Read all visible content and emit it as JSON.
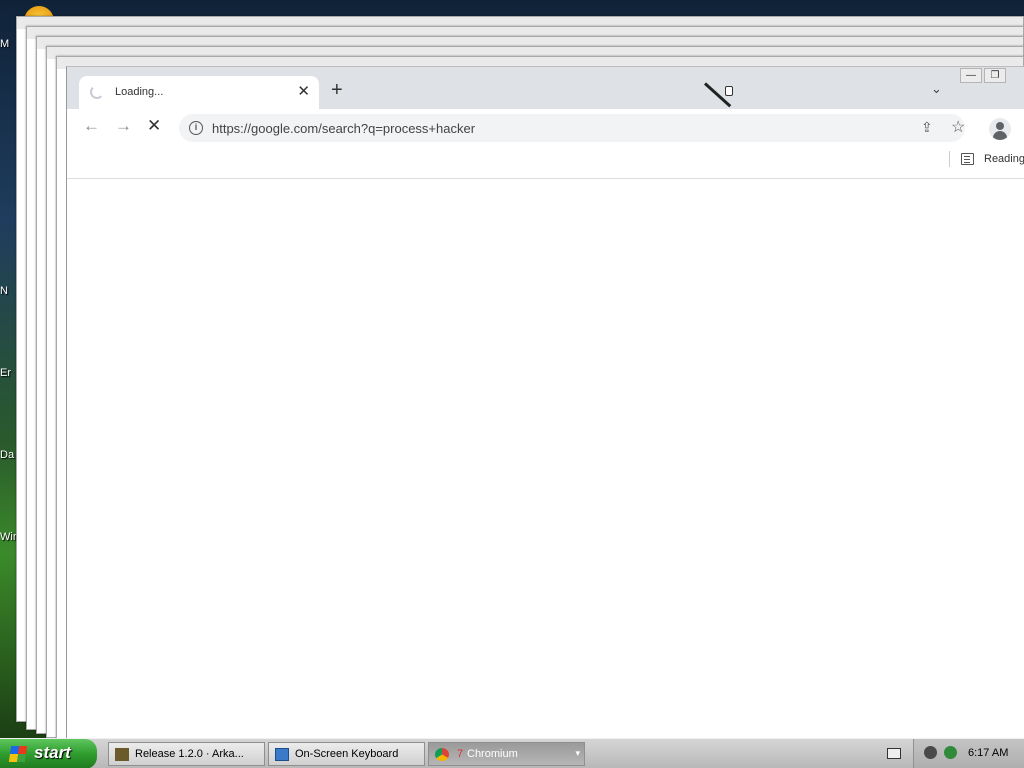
{
  "desktop": {
    "labels": [
      "M",
      "N",
      "Er",
      "Da",
      "Wir"
    ]
  },
  "browser": {
    "tab": {
      "title": "Loading...",
      "close_glyph": "✕"
    },
    "new_tab_glyph": "+",
    "tab_search_glyph": "⌄",
    "window_controls": {
      "minimize": "—",
      "restore": "❐"
    },
    "nav": {
      "back": "←",
      "forward": "→",
      "stop": "✕"
    },
    "omnibox": {
      "url": "https://google.com/search?q=process+hacker",
      "info_glyph": "i"
    },
    "share_glyph": "⇪",
    "bookmark_glyph": "☆",
    "reading_list_label": "Reading"
  },
  "taskbar": {
    "start_label": "start",
    "tasks": [
      {
        "label": "Release 1.2.0 · Arka..."
      },
      {
        "label": "On-Screen Keyboard"
      },
      {
        "label": "7 Chromium",
        "count": "7",
        "name": "Chromium"
      }
    ],
    "clock": "6:17 AM"
  },
  "colors": {
    "tabstrip": "#dee1e6",
    "omnibox": "#f1f3f4",
    "start_green": "#2e9d2e",
    "taskbar_gray": "#c7c7c7"
  }
}
